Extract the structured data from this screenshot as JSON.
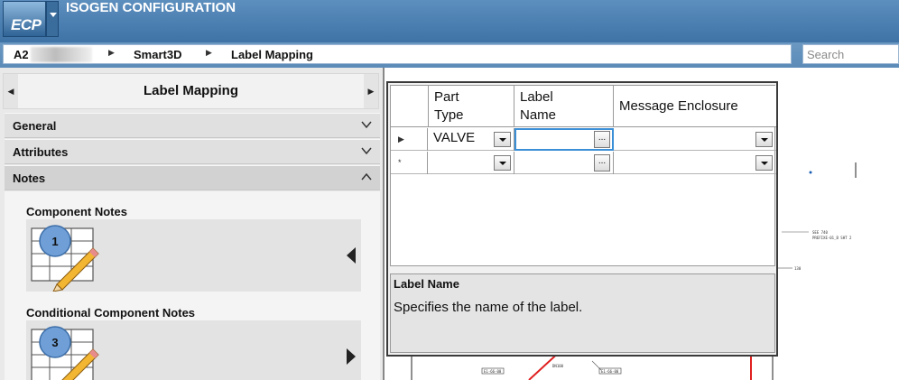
{
  "app": {
    "logo_text": "ECP",
    "title": "ISOGEN CONFIGURATION"
  },
  "breadcrumb": {
    "items": [
      "A2",
      "Smart3D",
      "Label Mapping"
    ]
  },
  "search": {
    "placeholder": "Search"
  },
  "left_panel": {
    "title": "Label Mapping",
    "sections": [
      {
        "label": "General",
        "state": "collapsed"
      },
      {
        "label": "Attributes",
        "state": "collapsed"
      },
      {
        "label": "Notes",
        "state": "expanded"
      }
    ],
    "notes": [
      {
        "title": "Component Notes",
        "badge": "1",
        "arrow": "left"
      },
      {
        "title": "Conditional Component Notes",
        "badge": "3",
        "arrow": "right"
      }
    ]
  },
  "grid": {
    "columns": [
      {
        "line1": "Part",
        "line2": "Type"
      },
      {
        "line1": "Label",
        "line2": "Name"
      },
      {
        "line1": "Message Enclosure",
        "line2": ""
      }
    ],
    "rows": [
      {
        "marker": "▶",
        "part_type": "VALVE",
        "label_name": "",
        "message_enclosure": ""
      },
      {
        "marker": "*",
        "part_type": "",
        "label_name": "",
        "message_enclosure": ""
      }
    ],
    "ellipsis_label": "..."
  },
  "info": {
    "title": "Label Name",
    "description": "Specifies the name of the label."
  },
  "drawing": {
    "texts": [
      "SEE 740",
      "PREFIXE-01_B SHT 2",
      "130",
      "E1-66-00",
      "E1-66-00",
      "DN100"
    ]
  }
}
